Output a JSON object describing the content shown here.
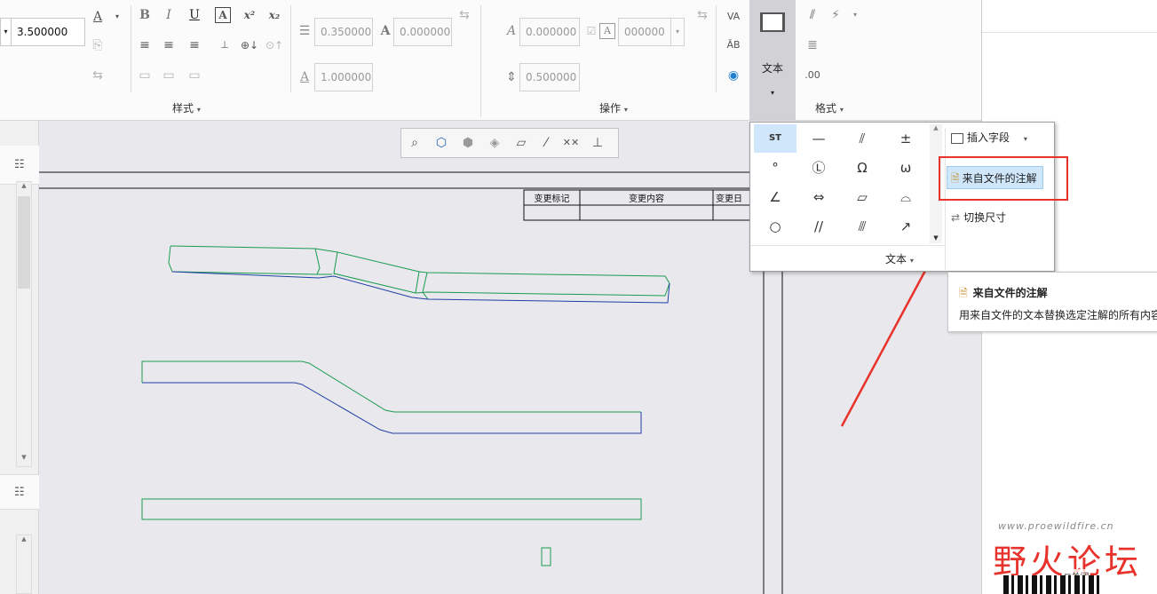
{
  "ribbon": {
    "height_value": "3.500000",
    "style_group_label": "样式",
    "ops_group_label": "操作",
    "format_group_label": "格式",
    "text_big_button_label": "文本",
    "fields": {
      "slant": "0.350000",
      "width_factor": "0.000000",
      "spacing": "1.000000",
      "angle": "0.000000",
      "mirror": "000000",
      "line_spacing": "0.500000"
    },
    "bold_label": "B",
    "italic_label": "I",
    "underline_label": "U",
    "superscript_label": "x²",
    "subscript_label": "x₂"
  },
  "canvas": {
    "title_block_headers": [
      "变更标记",
      "变更内容",
      "变更日"
    ]
  },
  "symbol_palette": {
    "symbols": [
      "ST",
      "—",
      "⫽",
      "±",
      "°",
      "Ⓛ",
      "Ω",
      "ω",
      "∠",
      "⇔",
      "▱",
      "⌓",
      "○",
      "//",
      "⫻",
      "↗"
    ],
    "footer_label": "文本"
  },
  "context_menu": {
    "insert_field_label": "插入字段",
    "from_file_label": "来自文件的注解",
    "toggle_dim_label": "切换尺寸"
  },
  "tooltip": {
    "title": "来自文件的注解",
    "description": "用来自文件的文本替换选定注解的所有内容"
  },
  "watermark": {
    "brand": "野火论坛",
    "url": "www.proewildfire.cn",
    "close_label": "关闭"
  },
  "colors": {
    "highlight_red": "#e8322b",
    "model_green": "#1a9a50",
    "model_blue": "#1f3fa6",
    "selected_blue": "#cfe6fb"
  }
}
